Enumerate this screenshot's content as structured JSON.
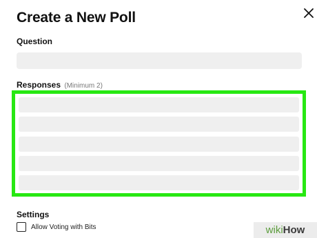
{
  "dialog": {
    "title": "Create a New Poll",
    "close_icon": "close-icon"
  },
  "question": {
    "label": "Question",
    "value": "",
    "placeholder": ""
  },
  "responses": {
    "label": "Responses",
    "hint": "(Minimum 2)",
    "highlight_color": "#27e812",
    "items": [
      {
        "value": ""
      },
      {
        "value": ""
      },
      {
        "value": ""
      },
      {
        "value": ""
      },
      {
        "value": ""
      }
    ]
  },
  "settings": {
    "label": "Settings",
    "allow_bits_label": "Allow Voting with Bits",
    "allow_bits_checked": false
  },
  "watermark": {
    "part1": "wiki",
    "part2": "How"
  }
}
